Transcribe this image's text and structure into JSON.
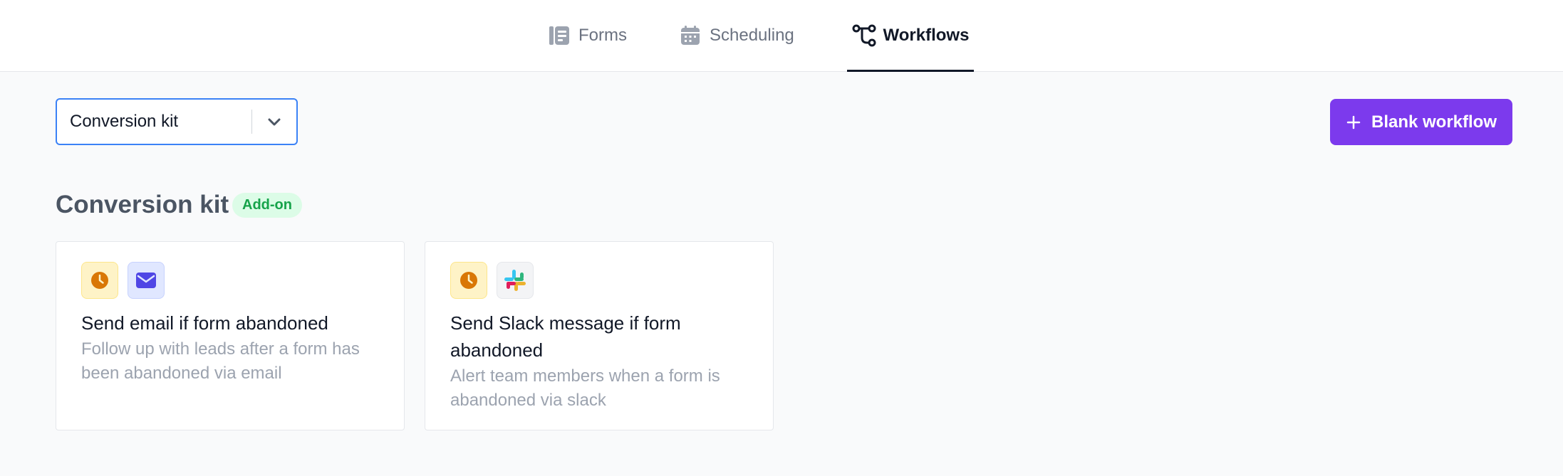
{
  "nav": {
    "tabs": [
      {
        "label": "Forms",
        "icon": "forms-icon"
      },
      {
        "label": "Scheduling",
        "icon": "calendar-icon"
      },
      {
        "label": "Workflows",
        "icon": "workflow-icon",
        "active": true
      }
    ]
  },
  "toolbar": {
    "select_value": "Conversion kit",
    "blank_button_label": "Blank workflow"
  },
  "section": {
    "title": "Conversion kit",
    "badge": "Add-on"
  },
  "cards": [
    {
      "title": "Send email if form abandoned",
      "description": "Follow up with leads after a form has been abandoned via email",
      "icons": [
        "clock-icon",
        "mail-icon"
      ]
    },
    {
      "title": "Send Slack message if form abandoned",
      "description": "Alert team members when a form is abandoned via slack",
      "icons": [
        "clock-icon",
        "slack-icon"
      ]
    }
  ],
  "colors": {
    "accent": "#7c3aed",
    "select_border": "#3b82f6",
    "badge_bg": "#dcfce7",
    "badge_text": "#16a34a",
    "clock": "#d97706",
    "mail": "#4f46e5"
  }
}
